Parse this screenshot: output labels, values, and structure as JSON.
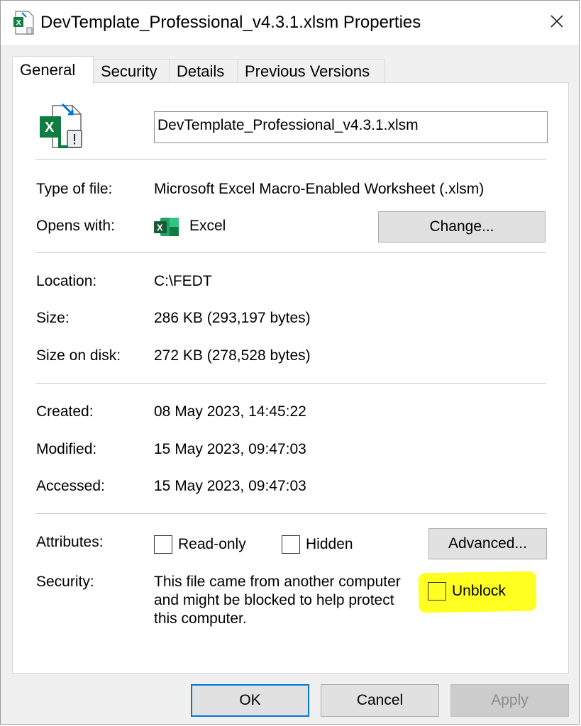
{
  "window": {
    "title": "DevTemplate_Professional_v4.3.1.xlsm Properties",
    "close_symbol": "✕"
  },
  "tabs": [
    {
      "label": "General",
      "active": true
    },
    {
      "label": "Security",
      "active": false
    },
    {
      "label": "Details",
      "active": false
    },
    {
      "label": "Previous Versions",
      "active": false
    }
  ],
  "general": {
    "file_name": "DevTemplate_Professional_v4.3.1.xlsm",
    "type_label": "Type of file:",
    "type_value": "Microsoft Excel Macro-Enabled Worksheet (.xlsm)",
    "opens_label": "Opens with:",
    "opens_value": "Excel",
    "change_button": "Change...",
    "location_label": "Location:",
    "location_value": "C:\\FEDT",
    "size_label": "Size:",
    "size_value": "286 KB (293,197 bytes)",
    "size_disk_label": "Size on disk:",
    "size_disk_value": "272 KB (278,528 bytes)",
    "created_label": "Created:",
    "created_value": "08 May 2023, 14:45:22",
    "modified_label": "Modified:",
    "modified_value": "15 May 2023, 09:47:03",
    "accessed_label": "Accessed:",
    "accessed_value": "15 May 2023, 09:47:03",
    "attributes_label": "Attributes:",
    "readonly_label": "Read-only",
    "readonly_checked": false,
    "hidden_label": "Hidden",
    "hidden_checked": false,
    "advanced_button": "Advanced...",
    "security_label": "Security:",
    "security_text": "This file came from another computer and might be blocked to help protect this computer.",
    "unblock_label": "Unblock",
    "unblock_checked": false,
    "highlight_color": "#ffff22"
  },
  "footer": {
    "ok": "OK",
    "cancel": "Cancel",
    "apply": "Apply"
  },
  "icons": {
    "file_icon": "excel-macro-file-icon",
    "app_icon": "excel-app-icon"
  },
  "colors": {
    "excel_green": "#107c41",
    "accent_blue": "#0078d7"
  }
}
